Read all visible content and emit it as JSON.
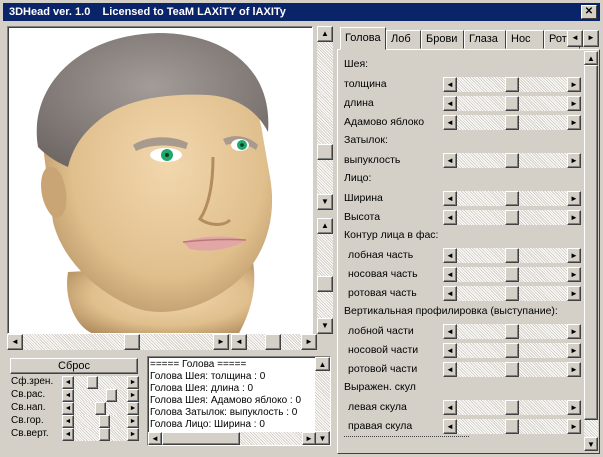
{
  "window": {
    "title": "3DHead ver. 1.0    Licensed to TeaM LAXiTY of lAXITy",
    "close_glyph": "✕"
  },
  "colors": {
    "titlebar": "#0a246a",
    "face": "#d4d0c8",
    "skin": "#e6c79a",
    "hair": "#8a8380",
    "iris": "#1fa86a",
    "lips": "#e2a6a6"
  },
  "tabs": [
    {
      "label": "Голова",
      "active": true
    },
    {
      "label": "Лоб",
      "active": false
    },
    {
      "label": "Брови",
      "active": false
    },
    {
      "label": "Глаза",
      "active": false
    },
    {
      "label": "Нос",
      "active": false
    },
    {
      "label": "Рот",
      "active": false
    }
  ],
  "tab_nav": {
    "left": "◄",
    "right": "►"
  },
  "panel": {
    "neck": {
      "title": "Шея:",
      "items": [
        {
          "label": "толщина",
          "value": 0.5
        },
        {
          "label": "длина",
          "value": 0.5
        },
        {
          "label": "Адамово яблоко",
          "value": 0.5
        }
      ]
    },
    "nape": {
      "title": "Затылок:",
      "items": [
        {
          "label": "выпуклость",
          "value": 0.5
        }
      ]
    },
    "face": {
      "title": "Лицо:",
      "items": [
        {
          "label": "Ширина",
          "value": 0.5
        },
        {
          "label": "Высота",
          "value": 0.5
        }
      ]
    },
    "contour": {
      "title": "Контур лица в фас:",
      "items": [
        {
          "label": "лобная часть",
          "value": 0.5
        },
        {
          "label": "носовая часть",
          "value": 0.5
        },
        {
          "label": "ротовая часть",
          "value": 0.5
        }
      ]
    },
    "profile": {
      "title": "Вертикальная профилировка (выступание):",
      "items": [
        {
          "label": "лобной части",
          "value": 0.5
        },
        {
          "label": "носовой части",
          "value": 0.5
        },
        {
          "label": "ротовой части",
          "value": 0.5
        }
      ]
    },
    "cheek": {
      "title": "Выражен. скул",
      "items": [
        {
          "label": "левая скула",
          "value": 0.5
        },
        {
          "label": "правая скула",
          "value": 0.5
        }
      ]
    }
  },
  "reset_button": "Сброс",
  "view_controls": [
    {
      "label": "Сф.зрен.",
      "value": 0.3
    },
    {
      "label": "Св.рас.",
      "value": 0.75
    },
    {
      "label": "Св.нап.",
      "value": 0.5
    },
    {
      "label": "Св.гор.",
      "value": 0.6
    },
    {
      "label": "Св.верт.",
      "value": 0.6
    }
  ],
  "log": [
    "=====     Голова     =====",
    "Голова Шея: толщина : 0",
    "Голова Шея: длина : 0",
    "Голова Шея: Адамово яблоко : 0",
    "Голова Затылок: выпуклость : 0",
    "Голова Лицо: Ширина : 0"
  ]
}
